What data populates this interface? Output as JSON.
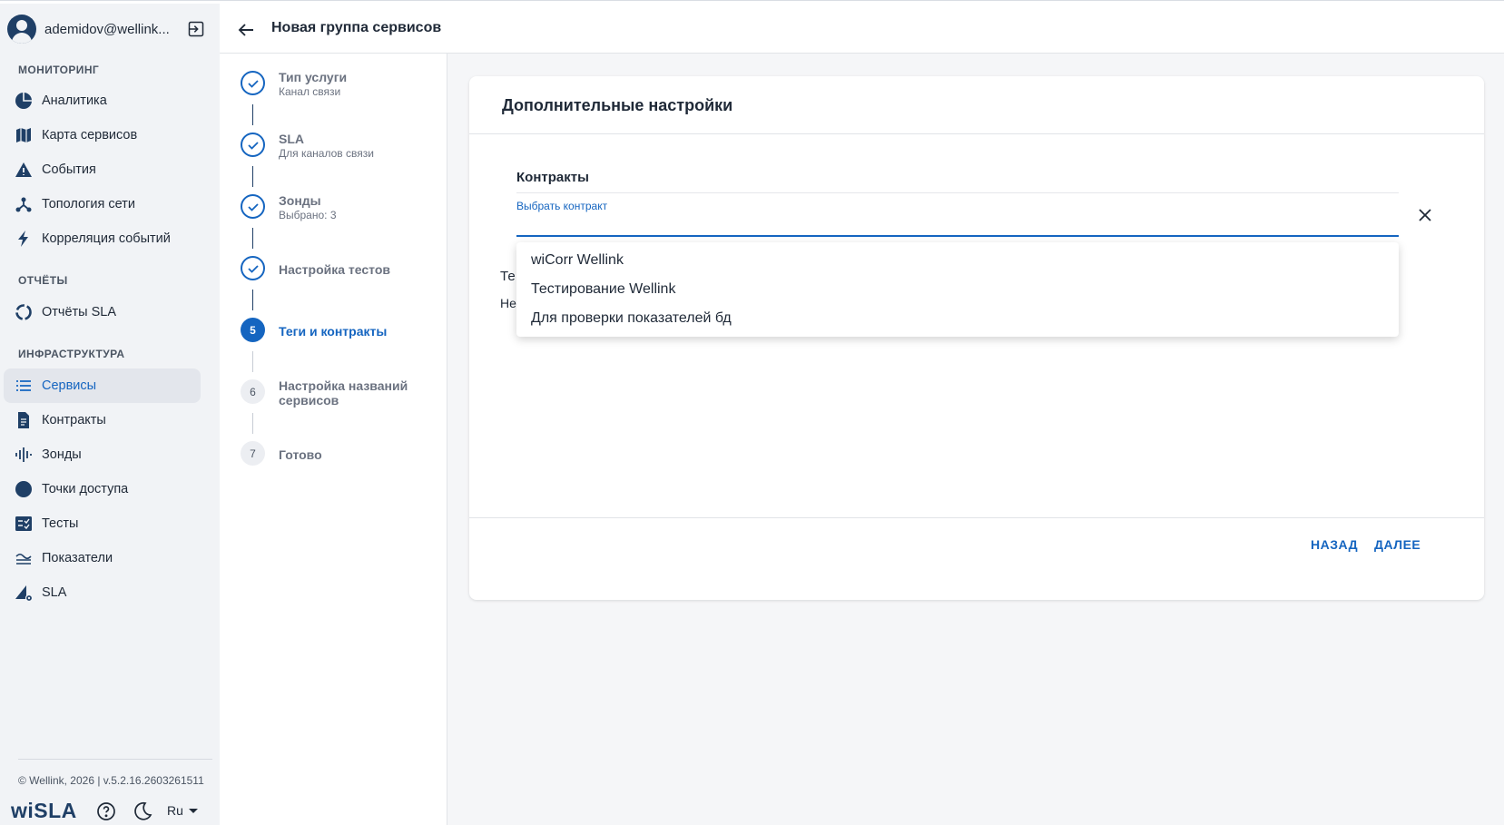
{
  "user": {
    "email": "ademidov@wellink..."
  },
  "sidebar": {
    "sections": [
      {
        "title": "МОНИТОРИНГ"
      },
      {
        "title": "ОТЧЁТЫ"
      },
      {
        "title": "ИНФРАСТРУКТУРА"
      }
    ],
    "items": [
      {
        "label": "Аналитика",
        "icon": "pie-chart-icon"
      },
      {
        "label": "Карта сервисов",
        "icon": "map-icon"
      },
      {
        "label": "События",
        "icon": "warning-icon"
      },
      {
        "label": "Топология сети",
        "icon": "topology-icon"
      },
      {
        "label": "Корреляция событий",
        "icon": "lightning-icon"
      },
      {
        "label": "Отчёты SLA",
        "icon": "circle-progress-icon"
      },
      {
        "label": "Сервисы",
        "icon": "list-icon",
        "active": true
      },
      {
        "label": "Контракты",
        "icon": "document-icon"
      },
      {
        "label": "Зонды",
        "icon": "waveform-icon"
      },
      {
        "label": "Точки доступа",
        "icon": "dot-icon"
      },
      {
        "label": "Тесты",
        "icon": "checklist-icon"
      },
      {
        "label": "Показатели",
        "icon": "metrics-icon"
      },
      {
        "label": "SLA",
        "icon": "sla-settings-icon"
      }
    ],
    "footer": {
      "copyright": "© Wellink, 2026 | v.5.2.16.2603261511",
      "logo": "wiSLA",
      "language": "Ru"
    }
  },
  "header": {
    "title": "Новая группа сервисов"
  },
  "steps": [
    {
      "marker": "",
      "title": "Тип услуги",
      "subtitle": "Канал связи",
      "state": "done"
    },
    {
      "marker": "",
      "title": "SLA",
      "subtitle": "Для каналов связи",
      "state": "done"
    },
    {
      "marker": "",
      "title": "Зонды",
      "subtitle": "Выбрано: 3",
      "state": "done"
    },
    {
      "marker": "",
      "title": "Настройка тестов",
      "subtitle": "",
      "state": "done"
    },
    {
      "marker": "5",
      "title": "Теги и контракты",
      "subtitle": "",
      "state": "active"
    },
    {
      "marker": "6",
      "title": "Настройка названий сервисов",
      "subtitle": "",
      "state": "todo"
    },
    {
      "marker": "7",
      "title": "Готово",
      "subtitle": "",
      "state": "todo"
    }
  ],
  "card": {
    "title": "Дополнительные настройки",
    "section_title": "Контракты",
    "field_label": "Выбрать контракт",
    "hidden_label_1": "Те",
    "hidden_label_2": "Не",
    "back_label": "НАЗАД",
    "next_label": "ДАЛЕЕ"
  },
  "dropdown": {
    "options": [
      "wiCorr Wellink",
      "Тестирование Wellink",
      "Для проверки показателей бд"
    ]
  },
  "colors": {
    "accent": "#1565c0",
    "sidebar_bg": "#f1f3f6",
    "brand_dark": "#1f3f66"
  }
}
